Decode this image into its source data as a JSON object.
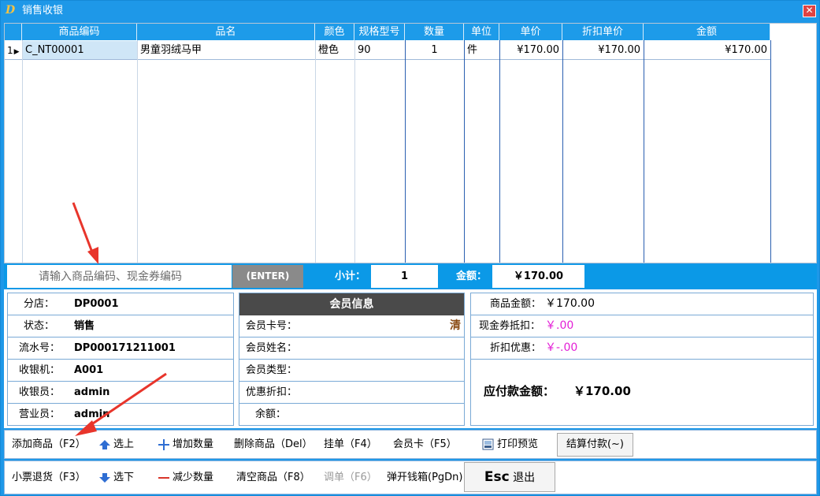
{
  "window": {
    "title": "销售收银",
    "close": "✕",
    "app_icon": "D"
  },
  "grid": {
    "columns": [
      "商品编码",
      "品名",
      "颜色",
      "规格型号",
      "数量",
      "单位",
      "单价",
      "折扣单价",
      "金额"
    ],
    "rows": [
      {
        "index": "1",
        "marker": "▶",
        "code": "C_NT00001",
        "name": "男童羽绒马甲",
        "color": "橙色",
        "spec": "90",
        "qty": "1",
        "unit": "件",
        "price": "¥170.00",
        "disc_price": "¥170.00",
        "amount": "¥170.00"
      }
    ]
  },
  "input_bar": {
    "placeholder": "请输入商品编码、现金券编码",
    "enter_label": "(ENTER)",
    "subtotal_label": "小计：",
    "subtotal_value": "1",
    "amount_label": "金额：",
    "amount_value": "￥170.00"
  },
  "store_info": [
    {
      "label": "分店：",
      "value": "DP0001"
    },
    {
      "label": "状态：",
      "value": "销售"
    },
    {
      "label": "流水号：",
      "value": "DP000171211001"
    },
    {
      "label": "收银机：",
      "value": "A001"
    },
    {
      "label": "收银员：",
      "value": "admin"
    },
    {
      "label": "营业员：",
      "value": "admin"
    }
  ],
  "member": {
    "title": "会员信息",
    "clear_label": "清",
    "fields": [
      {
        "label": "会员卡号："
      },
      {
        "label": "会员姓名："
      },
      {
        "label": "会员类型："
      },
      {
        "label": "优惠折扣："
      },
      {
        "label": "余额："
      }
    ]
  },
  "summary": {
    "goods_amount_label": "商品金额：",
    "goods_amount_value": "￥170.00",
    "voucher_label": "现金券抵扣：",
    "voucher_value": "￥.00",
    "discount_label": "折扣优惠：",
    "discount_value": "￥-.00",
    "payable_label": "应付款金额：",
    "payable_value": "￥170.00"
  },
  "toolbar1": {
    "add_goods": "添加商品（F2）",
    "select_up": "选上",
    "add_qty": "增加数量",
    "delete_goods": "删除商品（Del）",
    "hold": "挂单（F4）",
    "member_card": "会员卡（F5）",
    "print_preview": "打印预览",
    "checkout": "结算付款(~)"
  },
  "toolbar2": {
    "refund": "小票退货（F3）",
    "select_down": "选下",
    "reduce_qty": "减少数量",
    "clear_goods": "清空商品（F8）",
    "recall": "调单（F6）",
    "cash_drawer": "弹开钱箱(PgDn)",
    "esc_key": "Esc",
    "exit": "退出"
  },
  "colors": {
    "accent": "#1e98e8",
    "header_dark": "#4a4a4a",
    "magenta": "#e31fd6",
    "annotation_red": "#e8352b"
  },
  "icons": [
    "app-logo-icon",
    "close-icon",
    "row-pointer-icon",
    "arrow-up-icon",
    "plus-icon",
    "arrow-down-icon",
    "minus-icon",
    "print-preview-icon",
    "annotation-arrow-icon"
  ]
}
